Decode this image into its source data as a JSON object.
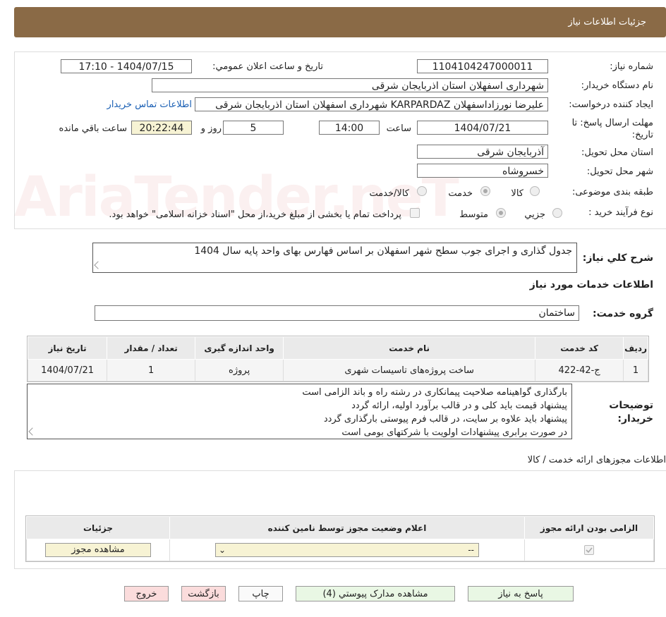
{
  "header": {
    "title": "جزئیات اطلاعات نیاز"
  },
  "watermark": "AriaTender.neT",
  "form": {
    "need_number_label": "شماره نیاز:",
    "need_number": "1104104247000011",
    "announce_label": "تاریخ و ساعت اعلان عمومي:",
    "announce_value": "1404/07/15 - 17:10",
    "buyer_label": "نام دستگاه خريدار:",
    "buyer_value": "شهرداری اسفهلان استان اذربایجان شرقی",
    "creator_label": "ايجاد کننده درخواست:",
    "creator_value": "علیرضا نورزاداسفهلان KARPARDAZ شهرداری اسفهلان استان اذربایجان شرقی",
    "contact_link": "اطلاعات تماس خريدار",
    "deadline_label": "مهلت ارسال پاسخ: تا تاريخ:",
    "deadline_date": "1404/07/21",
    "time_label": "ساعت",
    "deadline_time": "14:00",
    "days_value": "5",
    "days_label": "روز و",
    "remaining_time": "20:22:44",
    "remaining_label": "ساعت باقي مانده",
    "province_label": "استان محل تحويل:",
    "province_value": "آذربایجان شرقی",
    "city_label": "شهر محل تحويل:",
    "city_value": "خسروشاه",
    "category_label": "طبقه بندی موضوعی:",
    "category_options": [
      "کالا",
      "خدمت",
      "کالا/خدمت"
    ],
    "category_selected": "خدمت",
    "process_label": "نوع فرآيند خريد :",
    "process_options": [
      "جزيي",
      "متوسط"
    ],
    "process_selected": "متوسط",
    "payment_note": "پرداخت تمام يا بخشی از مبلغ خريد،از محل \"اسناد خزانه اسلامی\" خواهد بود."
  },
  "summary": {
    "label": "شرح کلي نياز:",
    "value": "جدول گذاری و اجرای جوب سطح شهر اسفهلان بر اساس فهارس بهای واحد پایه سال 1404"
  },
  "services": {
    "section_title": "اطلاعات خدمات مورد نياز",
    "group_label": "گروه خدمت:",
    "group_value": "ساختمان",
    "columns": [
      "رديف",
      "کد خدمت",
      "نام خدمت",
      "واحد اندازه گيری",
      "تعداد / مقدار",
      "تاريخ نياز"
    ],
    "rows": [
      [
        "1",
        "ج-42-422",
        "ساخت پروژه‌های تاسیسات شهری",
        "پروژه",
        "1",
        "1404/07/21"
      ]
    ]
  },
  "buyer_notes": {
    "label": "توضيحات خريدار:",
    "lines": [
      "بارگذاری گواهینامه صلاحیت پیمانکاری در رشته راه و باند الزامی است",
      "پیشنهاد قیمت باید کلی و در قالب برآورد اولیه، ارائه گردد",
      "پیشنهاد باید علاوه بر سایت، در قالب فرم پیوستی بارگذاری گردد",
      "در صورت برابری پیشنهادات اولویت با شرکتهای بومی است"
    ]
  },
  "permits": {
    "section_title": "اطلاعات مجوزهای ارائه خدمت / کالا",
    "columns": [
      "الزامی بودن ارائه مجوز",
      "اعلام وضعيت مجوز توسط نامين کننده",
      "جزئيات"
    ],
    "select_value": "--",
    "view_button": "مشاهده مجوز"
  },
  "buttons": {
    "reply": "پاسخ به نیاز",
    "attachments": "مشاهده مدارک پیوستي (4)",
    "print": "چاپ",
    "back": "بازگشت",
    "exit": "خروج"
  }
}
